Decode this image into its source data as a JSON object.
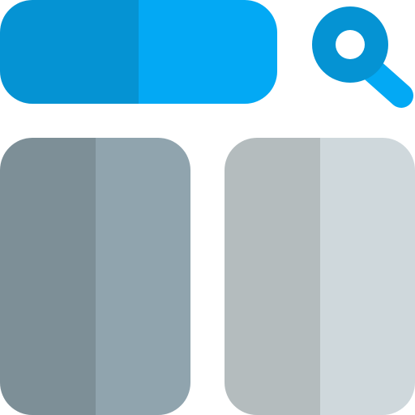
{
  "icon": {
    "name": "search-layout-icon",
    "colors": {
      "search_bar_left": "#0593d3",
      "search_bar_right": "#03a9f4",
      "magnifier_ring": "#0593d3",
      "magnifier_handle": "#03a9f4",
      "magnifier_lens": "#ffffff",
      "panel_left_shade": "#7d8f97",
      "panel_left_light": "#90a4ae",
      "panel_right_shade": "#b4bcbe",
      "panel_right_light": "#cfd8dc"
    }
  }
}
